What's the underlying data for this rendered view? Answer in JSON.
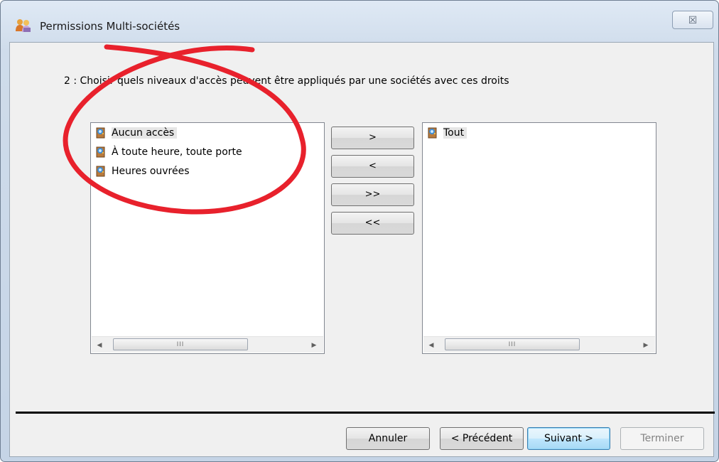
{
  "window": {
    "title": "Permissions Multi-sociétés",
    "close_label": "☒"
  },
  "wizard": {
    "instruction": "2 : Choisir quels niveaux d'accès peuvent être appliqués par une sociétés avec ces droits"
  },
  "available_list": {
    "items": [
      {
        "label": "Aucun accès",
        "icon": "door-icon",
        "selected": true
      },
      {
        "label": "À toute heure, toute porte",
        "icon": "door-icon"
      },
      {
        "label": "Heures ouvrées",
        "icon": "door-icon"
      }
    ],
    "scroll_arrow_left": "◀",
    "scroll_arrow_right": "▶",
    "scroll_grip": "III"
  },
  "selected_list": {
    "items": [
      {
        "label": "Tout",
        "icon": "door-icon",
        "selected": true
      }
    ],
    "scroll_arrow_left": "◀",
    "scroll_arrow_right": "▶",
    "scroll_grip": "III"
  },
  "move_buttons": {
    "add": ">",
    "remove": "<",
    "add_all": ">>",
    "remove_all": "<<"
  },
  "footer": {
    "cancel": "Annuler",
    "previous": "< Précédent",
    "next": "Suivant >",
    "finish": "Terminer"
  },
  "colors": {
    "annotation_red": "#e8212c",
    "default_button_border": "#3c7fb1",
    "title_gradient_top": "#dfe9f5"
  }
}
